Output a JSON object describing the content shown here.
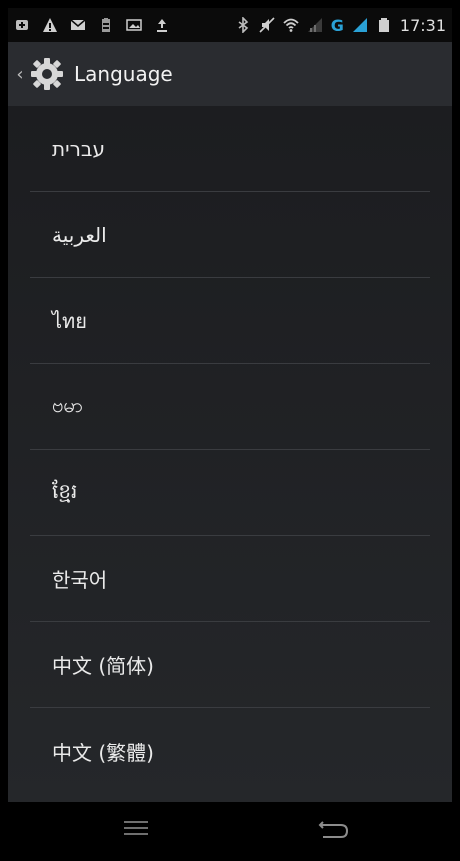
{
  "status_bar": {
    "time": "17:31",
    "network_type": "G",
    "icons": [
      "add-icon",
      "warning-icon",
      "mail-icon",
      "battery-saver-icon",
      "image-icon",
      "upload-icon",
      "bluetooth-icon",
      "mute-icon",
      "wifi-icon",
      "signal-icon",
      "signal-icon",
      "battery-icon"
    ]
  },
  "action_bar": {
    "title": "Language",
    "icon": "gear-icon"
  },
  "languages": [
    "עברית",
    "العربية",
    "ไทย",
    "ဗမာ",
    "ខ្មែរ",
    "한국어",
    "中文 (简体)",
    "中文 (繁體)"
  ],
  "colors": {
    "accent": "#2aa1d6",
    "actionbar_bg": "#2a2c30",
    "content_bg": "#1c1d20"
  }
}
